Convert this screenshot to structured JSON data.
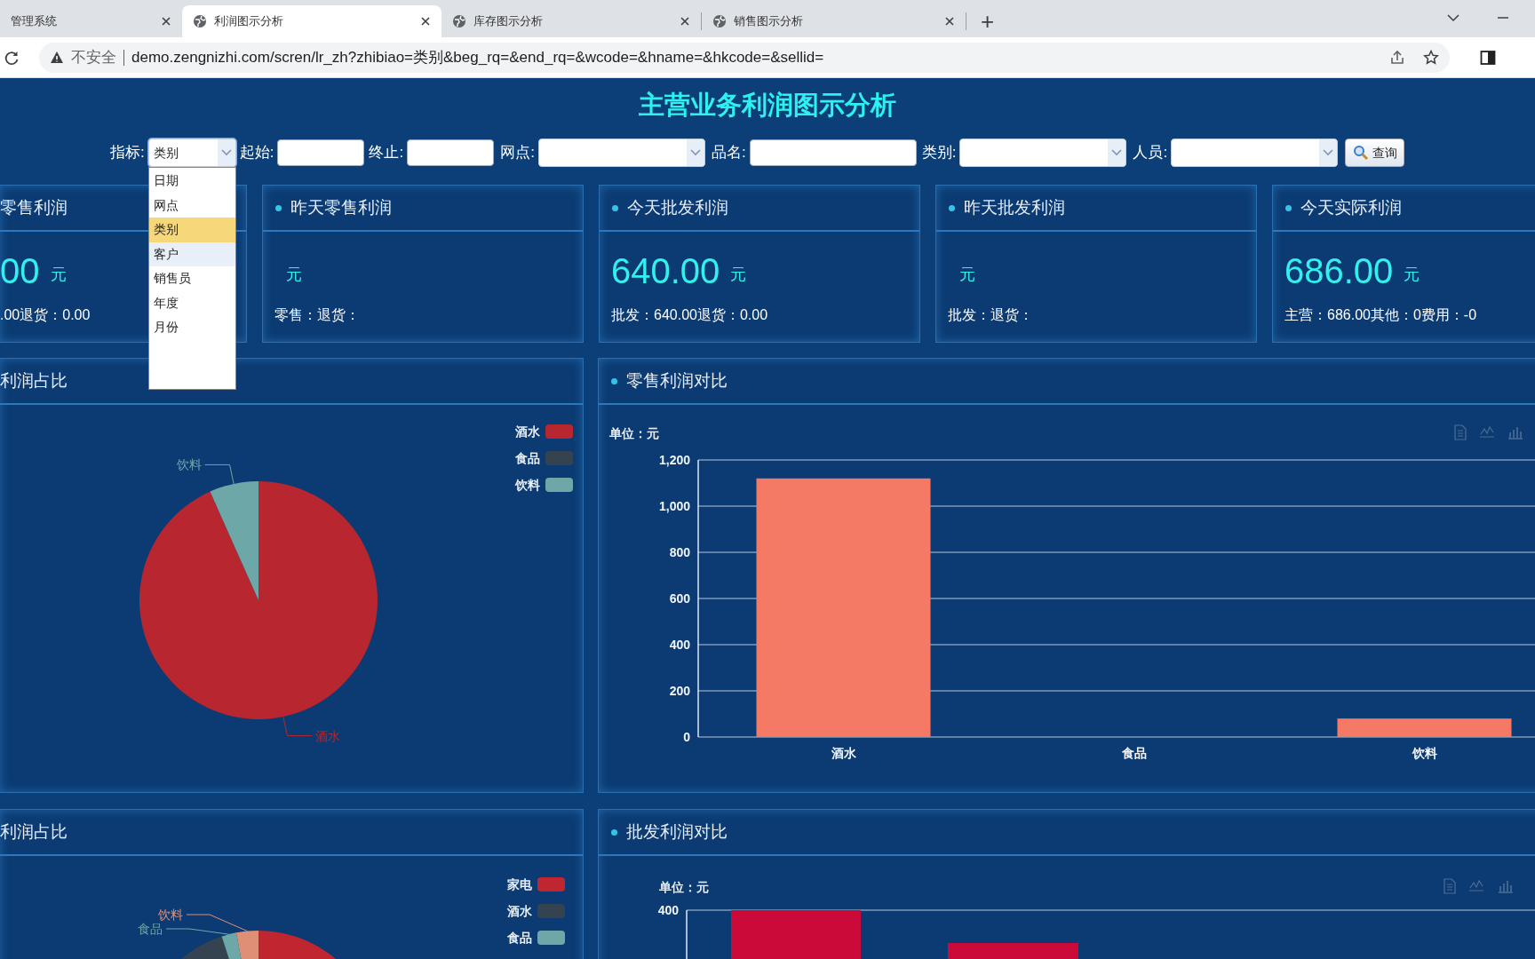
{
  "browser": {
    "tabs": [
      {
        "label": "管理系统",
        "selected": false,
        "favicon": false
      },
      {
        "label": "利润图示分析",
        "selected": true,
        "favicon": true
      },
      {
        "label": "库存图示分析",
        "selected": false,
        "favicon": true
      },
      {
        "label": "销售图示分析",
        "selected": false,
        "favicon": true
      }
    ],
    "new_tab": "+",
    "security": "不安全",
    "url": "demo.zengnizhi.com/scren/lr_zh?zhibiao=类别&beg_rq=&end_rq=&wcode=&hname=&hkcode=&sellid="
  },
  "page": {
    "title": "主营业务利润图示分析",
    "filters": [
      {
        "label": "指标:",
        "kind": "select",
        "value": "类别",
        "open": true,
        "options": [
          {
            "label": "日期",
            "selected": false,
            "hovered": false
          },
          {
            "label": "网点",
            "selected": false,
            "hovered": false
          },
          {
            "label": "类别",
            "selected": true,
            "hovered": false
          },
          {
            "label": "客户",
            "selected": false,
            "hovered": true
          },
          {
            "label": "销售员",
            "selected": false,
            "hovered": false
          },
          {
            "label": "年度",
            "selected": false,
            "hovered": false
          },
          {
            "label": "月份",
            "selected": false,
            "hovered": false
          }
        ]
      },
      {
        "label": "起始:",
        "kind": "input"
      },
      {
        "label": "终止:",
        "kind": "input"
      },
      {
        "label": "网点:",
        "kind": "select",
        "open": false
      },
      {
        "label": "品名:",
        "kind": "input"
      },
      {
        "label": "类别:",
        "kind": "select",
        "open": false
      },
      {
        "label": "人员:",
        "kind": "select",
        "open": false
      }
    ],
    "search_button": "查询",
    "cards": [
      {
        "title": "零售利润",
        "dot": false,
        "value": "00",
        "unit": "元",
        "detail": ".00退货：0.00"
      },
      {
        "title": "昨天零售利润",
        "dot": true,
        "unit": "元",
        "detail": "零售：退货："
      },
      {
        "title": "今天批发利润",
        "dot": true,
        "value": "640.00",
        "unit": "元",
        "detail": "批发：640.00退货：0.00"
      },
      {
        "title": "昨天批发利润",
        "dot": true,
        "unit": "元",
        "detail": "批发：退货："
      },
      {
        "title": "今天实际利润",
        "dot": true,
        "value": "686.00",
        "unit": "元",
        "detail": "主营：686.00其他：0费用：-0"
      }
    ],
    "retail_share": {
      "title": "利润占比",
      "slices": [
        {
          "legend": "酒水",
          "label": "酒水",
          "color": "#b8262f"
        },
        {
          "legend": "食品",
          "color": "#34434f"
        },
        {
          "legend": "饮料",
          "label": "饮料",
          "color": "#6ea7a8"
        }
      ]
    },
    "retail_compare": {
      "title": "零售利润对比",
      "chart_data": {
        "type": "bar",
        "ylabel": "单位：元",
        "categories": [
          "酒水",
          "食品",
          "饮料"
        ],
        "series": [
          {
            "color": "#f47a66",
            "values": [
              1120,
              0,
              80
            ]
          }
        ],
        "grid": true,
        "ylim": [
          0,
          1200
        ],
        "yticks": [
          0,
          200,
          400,
          600,
          800,
          {
            "value": 1000,
            "label": "1,000"
          },
          {
            "value": 1200,
            "label": "1,200"
          }
        ]
      }
    },
    "wholesale_share": {
      "title": "利润占比",
      "slice_labels": [
        {
          "text": "饮料",
          "color": "#e08f77"
        },
        {
          "text": "食品",
          "color": "#6ea7a8"
        }
      ],
      "legend": [
        {
          "label": "家电",
          "color": "#c0262f"
        },
        {
          "label": "酒水",
          "color": "#34434f"
        },
        {
          "label": "食品",
          "color": "#6ea7a8"
        }
      ]
    },
    "wholesale_compare": {
      "title": "批发利润对比",
      "unit": "单位：元",
      "tick": "400"
    }
  }
}
